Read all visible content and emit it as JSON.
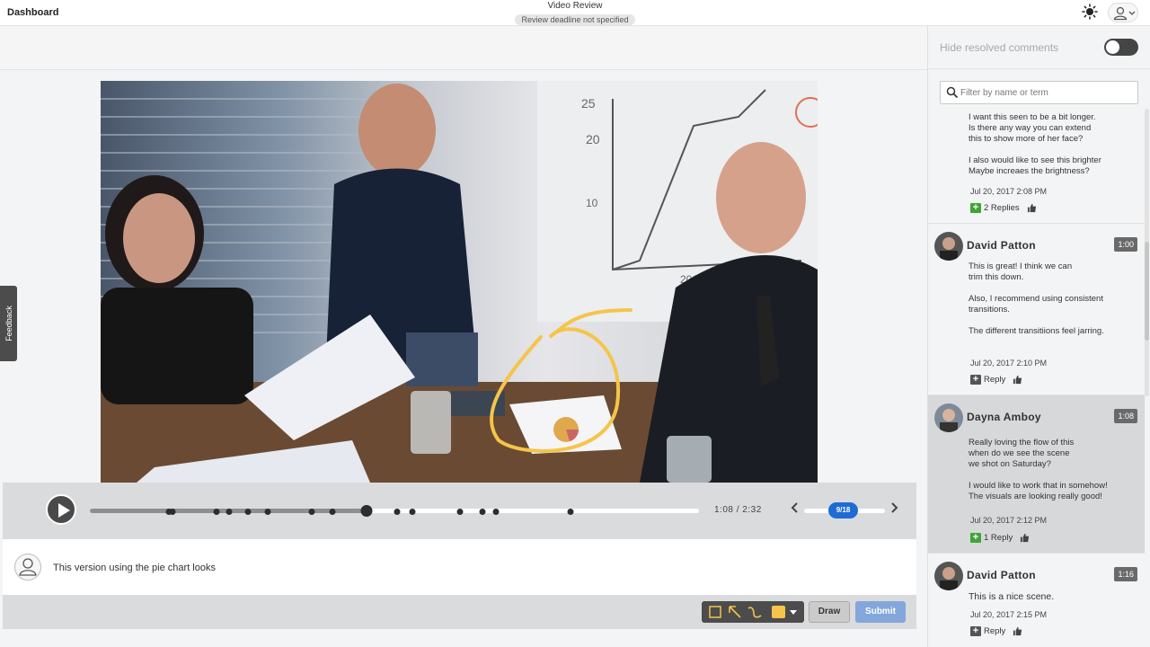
{
  "header": {
    "brand": "Dashboard",
    "title": "Video Review",
    "deadline": "Review deadline not specified"
  },
  "feedback_tab": "Feedback",
  "player": {
    "time": "1:08 / 2:32",
    "progress": 0.454,
    "counter": "9/18",
    "marker_positions": [
      0.13,
      0.135,
      0.208,
      0.229,
      0.26,
      0.292,
      0.365,
      0.398,
      0.505,
      0.529,
      0.608,
      0.644,
      0.667,
      0.789
    ]
  },
  "comment_input": {
    "text": "This version using the pie chart looks"
  },
  "tools": {
    "draw_label": "Draw",
    "submit_label": "Submit",
    "color": "#f5c44a"
  },
  "panel": {
    "hide_resolved_label": "Hide resolved comments",
    "filter_placeholder": "Filter by name or term"
  },
  "comments": [
    {
      "text": "I want this seen to be a bit longer.\nIs there any way you can extend\nthis to show more of her face?\n\nI also would like to see this brighter\nMaybe increaes the brightness?",
      "date": "Jul 20, 2017 2:08 PM",
      "reply_label": "2 Replies"
    },
    {
      "name": "David Patton",
      "time": "1:00",
      "text": "This is great! I think we can\ntrim this down.\n\nAlso, I recommend using consistent\ntransitions.\n\nThe different transitiions feel jarring.",
      "date": "Jul 20, 2017 2:10 PM",
      "reply_label": "Reply"
    },
    {
      "name": "Dayna Amboy",
      "time": "1:08",
      "text": "Really loving the flow of this\nwhen do we see the scene\nwe shot on Saturday?\n\nI would like to work that in somehow!\nThe visuals are looking really good!",
      "date": "Jul 20, 2017 2:12 PM",
      "reply_label": "1 Reply"
    },
    {
      "name": "David Patton",
      "time": "1:16",
      "text": "This is a nice scene.",
      "date": "Jul 20, 2017 2:15 PM",
      "reply_label": "Reply"
    }
  ],
  "colors": {
    "accent": "#1e6bd6",
    "submit": "#84a7db",
    "plus_green": "#3ea534",
    "annotation": "#f5c44a"
  }
}
